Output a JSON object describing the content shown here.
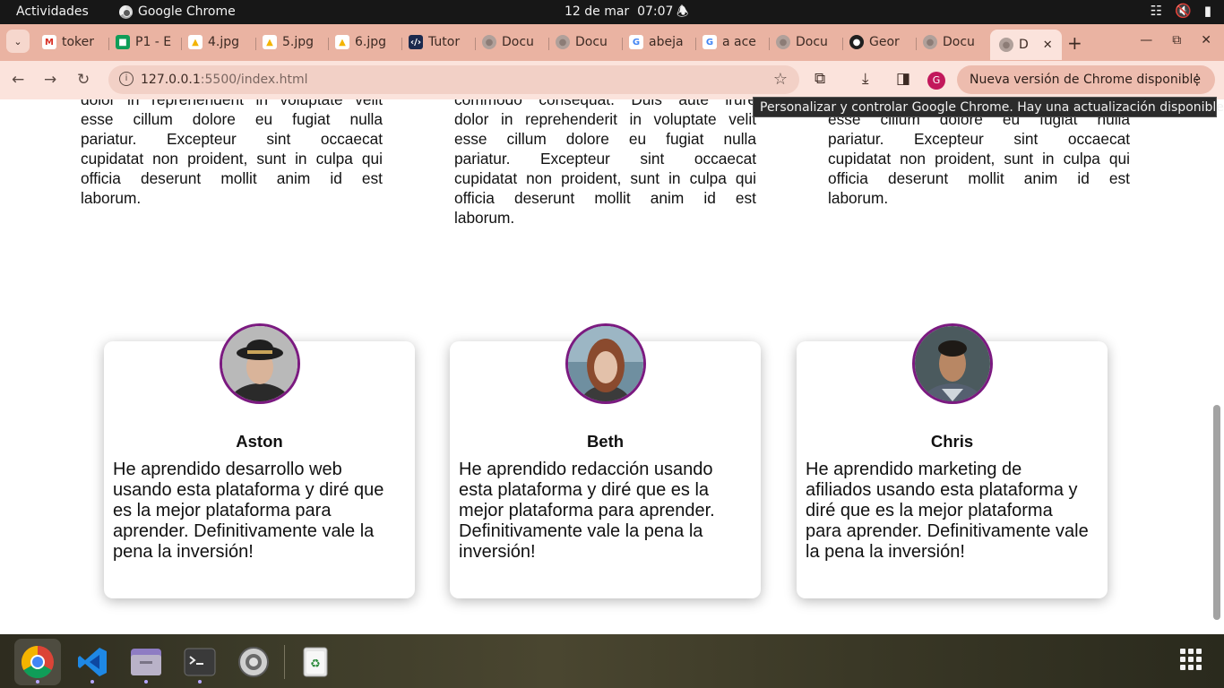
{
  "system_bar": {
    "activities": "Actividades",
    "app_name": "Google Chrome",
    "date": "12 de mar",
    "time": "07:07"
  },
  "tabs": [
    {
      "title": "toker",
      "icon": "gmail-icon"
    },
    {
      "title": "P1 - E",
      "icon": "classroom-icon"
    },
    {
      "title": "4.jpg",
      "icon": "google-drive-icon"
    },
    {
      "title": "5.jpg",
      "icon": "google-drive-icon"
    },
    {
      "title": "6.jpg",
      "icon": "google-drive-icon"
    },
    {
      "title": "Tutor",
      "icon": "code-icon"
    },
    {
      "title": "Docu",
      "icon": "globe-icon"
    },
    {
      "title": "Docu",
      "icon": "globe-icon"
    },
    {
      "title": "abeja",
      "icon": "google-icon"
    },
    {
      "title": "a ace",
      "icon": "google-icon"
    },
    {
      "title": "Docu",
      "icon": "globe-icon"
    },
    {
      "title": "Geor",
      "icon": "github-icon"
    },
    {
      "title": "Docu",
      "icon": "globe-icon"
    },
    {
      "title": "D",
      "icon": "globe-icon",
      "active": true
    }
  ],
  "toolbar": {
    "url_host": "127.0.0.1",
    "url_rest": ":5500/index.html",
    "profile_initial": "G",
    "update_label": "Nueva versión de Chrome disponible"
  },
  "tooltip": "Personalizar y controlar Google Chrome. Hay una actualización disponible.",
  "text_columns": [
    [
      "dolor in reprehenderit in voluptate velit",
      "esse cillum dolore eu fugiat nulla",
      "pariatur. Excepteur sint occaecat",
      "cupidatat non proident, sunt in culpa qui",
      "officia deserunt mollit anim id est",
      "laborum."
    ],
    [
      "commodo consequat. Duis aute irure",
      "dolor in reprehenderit in voluptate velit",
      "esse cillum dolore eu fugiat nulla",
      "pariatur. Excepteur sint occaecat",
      "cupidatat non proident, sunt in culpa qui",
      "officia deserunt mollit anim id est",
      "laborum."
    ],
    [
      "esse cillum dolore eu fugiat nulla",
      "pariatur. Excepteur sint occaecat",
      "cupidatat non proident, sunt in culpa qui",
      "officia deserunt mollit anim id est",
      "laborum."
    ]
  ],
  "testimonials": [
    {
      "name": "Aston",
      "quote": "He aprendido desarrollo web usando esta plataforma y diré que es la mejor plataforma para aprender. Definitivamente vale la pena la inversión!"
    },
    {
      "name": "Beth",
      "quote": "He aprendido redacción usando esta plataforma y diré que es la mejor plataforma para aprender. Definitivamente vale la pena la inversión!"
    },
    {
      "name": "Chris",
      "quote": "He aprendido marketing de afiliados usando esta plataforma y diré que es la mejor plataforma para aprender. Definitivamente vale la pena la inversión!"
    }
  ],
  "dock": [
    {
      "name": "chrome-icon",
      "active": true
    },
    {
      "name": "vscode-icon"
    },
    {
      "name": "files-icon"
    },
    {
      "name": "terminal-icon"
    },
    {
      "name": "settings-icon"
    },
    {
      "name": "trash-icon"
    }
  ],
  "colors": {
    "tab_strip": "#eab3a2",
    "toolbar": "#fbe3dc",
    "avatar_border": "#7b1a80"
  }
}
